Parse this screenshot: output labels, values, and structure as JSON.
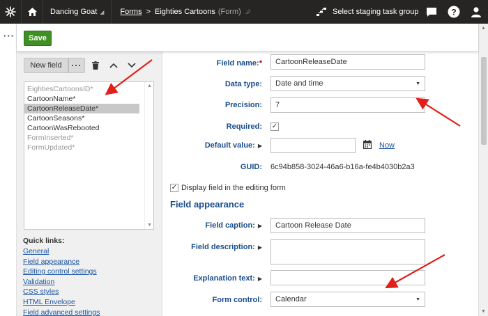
{
  "topbar": {
    "site_name": "Dancing Goat",
    "breadcrumb_forms": "Forms",
    "breadcrumb_sep": ">",
    "breadcrumb_current": "Eighties Cartoons",
    "breadcrumb_type": "(Form)",
    "staging_label": "Select staging task group"
  },
  "toolbar": {
    "save_label": "Save"
  },
  "left": {
    "new_field_label": "New field",
    "more_label": "···",
    "fields": [
      {
        "label": "EightiesCartoonsID*",
        "state": "disabled"
      },
      {
        "label": "CartoonName*",
        "state": "normal"
      },
      {
        "label": "CartoonReleaseDate*",
        "state": "selected"
      },
      {
        "label": "CartoonSeasons*",
        "state": "normal"
      },
      {
        "label": "CartoonWasRebooted",
        "state": "normal"
      },
      {
        "label": "FormInserted*",
        "state": "disabled"
      },
      {
        "label": "FormUpdated*",
        "state": "disabled"
      }
    ],
    "quick_links_title": "Quick links:",
    "quick_links": [
      "General",
      "Field appearance",
      "Editing control settings",
      "Validation",
      "CSS styles",
      "HTML Envelope",
      "Field advanced settings"
    ]
  },
  "form": {
    "field_name_label": "Field name:",
    "field_name_req": "*",
    "field_name_value": "CartoonReleaseDate",
    "data_type_label": "Data type:",
    "data_type_value": "Date and time",
    "precision_label": "Precision:",
    "precision_value": "7",
    "required_label": "Required:",
    "required_checked": true,
    "default_value_label": "Default value:",
    "default_value": "",
    "now_label": "Now",
    "guid_label": "GUID:",
    "guid_value": "6c94b858-3024-46a6-b16a-fe4b4030b2a3",
    "display_field_label": "Display field in the editing form",
    "section_title": "Field appearance",
    "field_caption_label": "Field caption:",
    "field_caption_value": "Cartoon Release Date",
    "field_description_label": "Field description:",
    "explanation_text_label": "Explanation text:",
    "form_control_label": "Form control:",
    "form_control_value": "Calendar"
  },
  "colors": {
    "topbar": "#262524",
    "save": "#3f8f25",
    "label": "#1a4e8c",
    "link": "#1a55a0",
    "arrow": "#e0201b"
  }
}
